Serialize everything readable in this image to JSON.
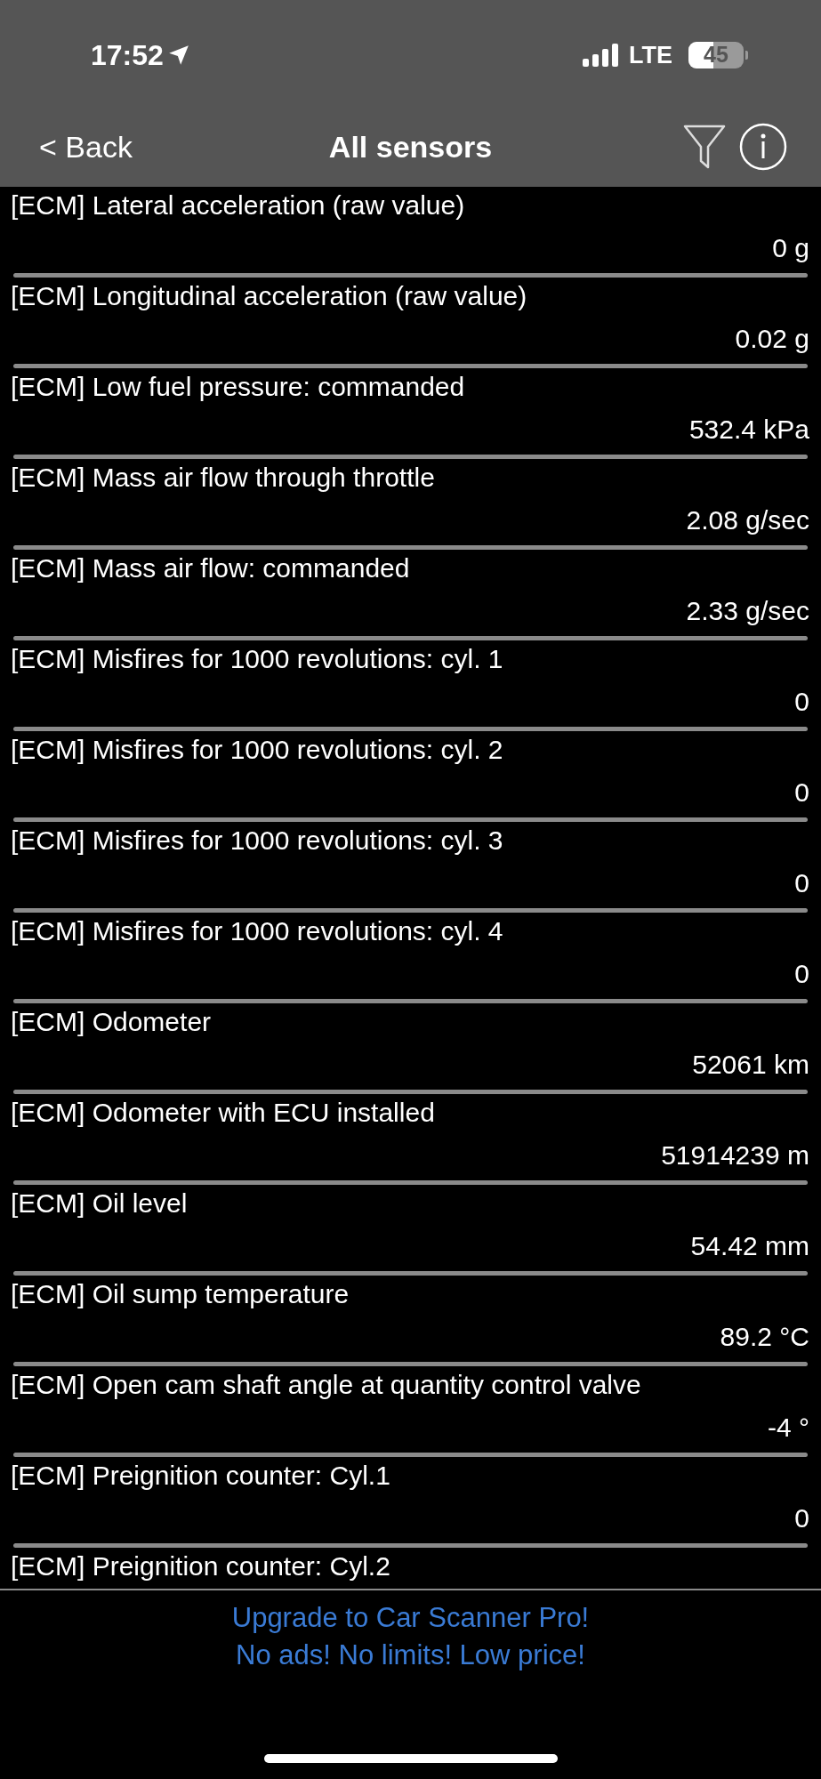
{
  "status_bar": {
    "time": "17:52",
    "network": "LTE",
    "battery": "45"
  },
  "nav": {
    "back": "< Back",
    "title": "All sensors"
  },
  "sensors": [
    {
      "name": "[ECM] Lateral acceleration (raw value)",
      "value": "0 g"
    },
    {
      "name": "[ECM] Longitudinal acceleration (raw value)",
      "value": "0.02 g"
    },
    {
      "name": "[ECM] Low fuel pressure: commanded",
      "value": "532.4 kPa"
    },
    {
      "name": "[ECM] Mass air flow through throttle",
      "value": "2.08 g/sec"
    },
    {
      "name": "[ECM] Mass air flow: commanded",
      "value": "2.33 g/sec"
    },
    {
      "name": "[ECM] Misfires for 1000 revolutions: cyl. 1",
      "value": "0"
    },
    {
      "name": "[ECM] Misfires for 1000 revolutions: cyl. 2",
      "value": "0"
    },
    {
      "name": "[ECM] Misfires for 1000 revolutions: cyl. 3",
      "value": "0"
    },
    {
      "name": "[ECM] Misfires for 1000 revolutions: cyl. 4",
      "value": "0"
    },
    {
      "name": "[ECM] Odometer",
      "value": "52061 km"
    },
    {
      "name": "[ECM] Odometer with ECU installed",
      "value": "51914239 m"
    },
    {
      "name": "[ECM] Oil level",
      "value": "54.42 mm"
    },
    {
      "name": "[ECM] Oil sump temperature",
      "value": "89.2 °C"
    },
    {
      "name": "[ECM] Open cam shaft angle at quantity control valve",
      "value": "-4 °"
    },
    {
      "name": "[ECM] Preignition counter: Cyl.1",
      "value": "0"
    },
    {
      "name": "[ECM] Preignition counter: Cyl.2"
    }
  ],
  "ad": [
    "Upgrade to Car Scanner Pro!",
    "No ads! No limits! Low price!"
  ]
}
